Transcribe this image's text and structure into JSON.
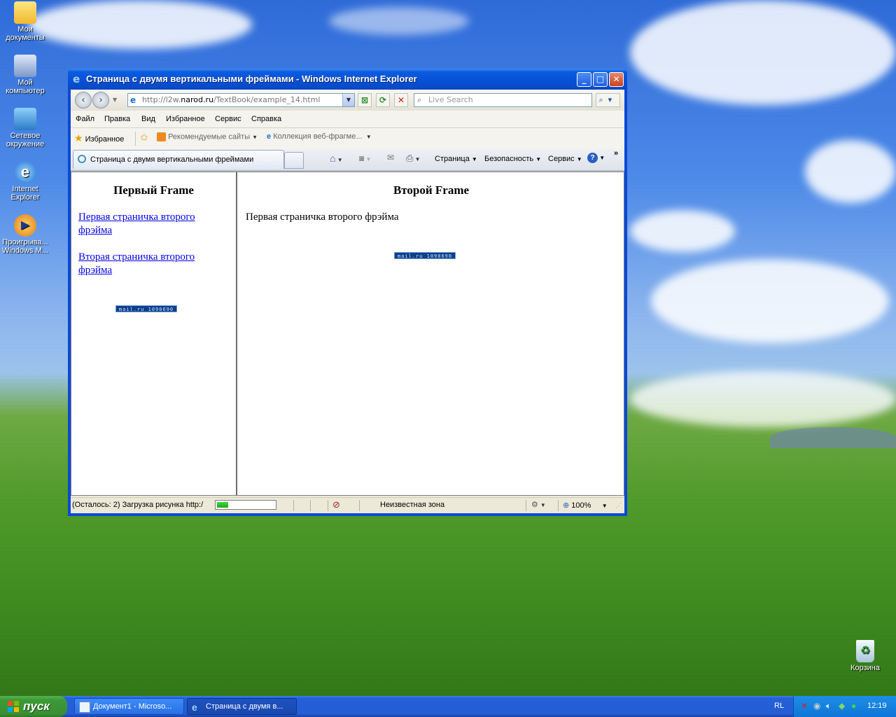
{
  "desktop": {
    "icons": [
      {
        "label": "Мои документы",
        "icon": "my-documents-icon"
      },
      {
        "label": "Мой компьютер",
        "icon": "my-computer-icon"
      },
      {
        "label": "Сетевое окружение",
        "icon": "network-icon"
      },
      {
        "label": "Internet Explorer",
        "icon": "ie-icon"
      },
      {
        "label": "Проигрыва... Windows M...",
        "icon": "media-player-icon"
      }
    ],
    "recycle_bin": "Корзина"
  },
  "window": {
    "title": "Страница с двумя вертикальными фреймами - Windows Internet Explorer",
    "address_prefix": "http://l2w.",
    "address_domain": "narod.ru",
    "address_path": "/TextBook/example_14.html",
    "search_placeholder": "Live Search",
    "menu": [
      "Файл",
      "Правка",
      "Вид",
      "Избранное",
      "Сервис",
      "Справка"
    ],
    "favorites": {
      "label": "Избранное",
      "suggested": "Рекомендуемые сайты",
      "gallery": "Коллекция веб-фрагме..."
    },
    "tab_label": "Страница с двумя вертикальными фреймами",
    "commands": {
      "page": "Страница",
      "safety": "Безопасность",
      "tools": "Сервис"
    }
  },
  "frame1": {
    "title": "Первый Frame",
    "link1": "Первая страничка второго фрэйма",
    "link2": "Вторая страничка второго фрэйма",
    "counter": "mail.ru 1090690"
  },
  "frame2": {
    "title": "Второй Frame",
    "text": "Первая страничка второго фрэйма",
    "counter": "mail.ru 1090690"
  },
  "status": {
    "text": "(Осталось: 2) Загрузка рисунка http:/",
    "zone": "Неизвестная зона",
    "zoom": "100%",
    "progress": 0.2
  },
  "taskbar": {
    "start": "пуск",
    "tasks": [
      "Документ1 - Microso...",
      "Страница с двумя в..."
    ],
    "lang": "RL",
    "clock": "12:19"
  }
}
